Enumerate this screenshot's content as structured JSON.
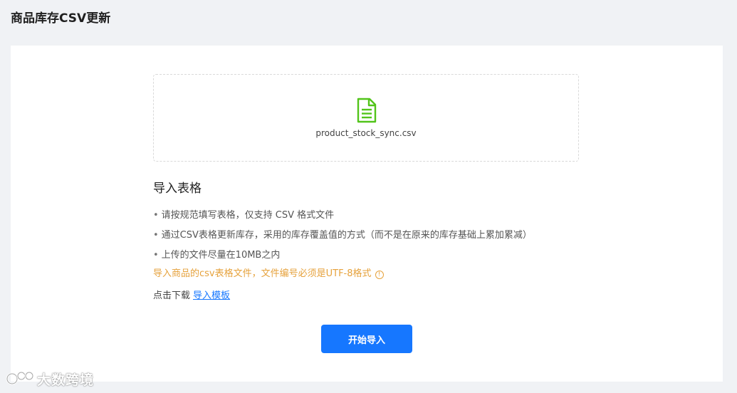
{
  "page": {
    "title": "商品库存CSV更新"
  },
  "upload": {
    "file_name": "product_stock_sync.csv",
    "icon": "file-document-icon",
    "icon_color": "#52c41a"
  },
  "instructions": {
    "title": "导入表格",
    "notes": [
      "请按规范填写表格，仅支持 CSV 格式文件",
      "通过CSV表格更新库存，采用的库存覆盖值的方式（而不是在原来的库存基础上累加累减）",
      "上传的文件尽量在10MB之内"
    ],
    "warning": "导入商品的csv表格文件，文件编号必须是UTF-8格式",
    "warning_icon": "info-circle-icon",
    "warning_color": "#e6a23c",
    "download_prefix": "点击下载",
    "download_link": "导入模板"
  },
  "actions": {
    "start_import": "开始导入",
    "primary_color": "#1677ff"
  },
  "watermark": {
    "text": "大数跨境"
  }
}
